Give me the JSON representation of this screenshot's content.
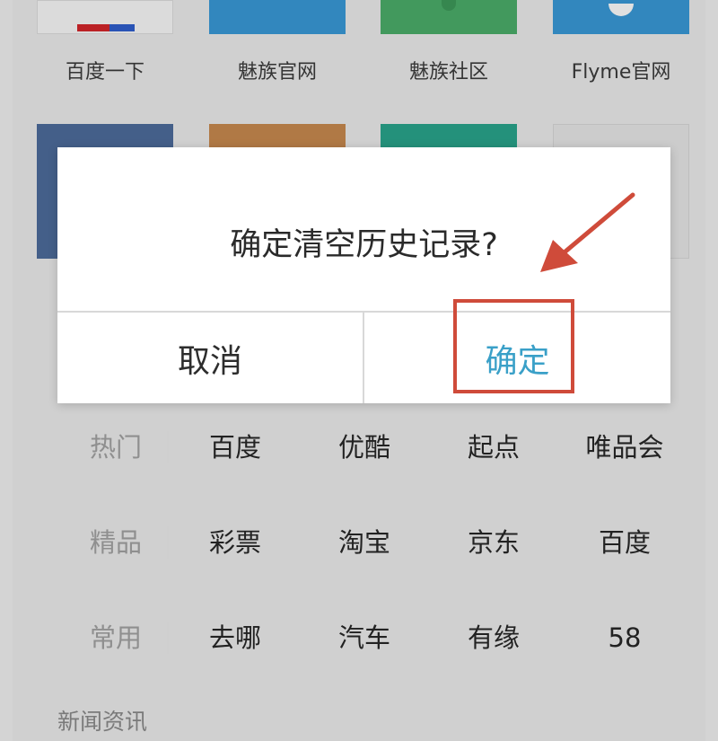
{
  "quick_links_top": [
    {
      "label": "百度一下",
      "color": "#ffffff"
    },
    {
      "label": "魅族官网",
      "color": "#3a9ad9"
    },
    {
      "label": "魅族社区",
      "color": "#4caf6a"
    },
    {
      "label": "Flyme官网",
      "color": "#3a9ad9"
    }
  ],
  "quick_links_second_row_colors": [
    "#4e6d9c",
    "#c98a4f",
    "#2aa68d",
    "#e9e9e9"
  ],
  "dialog": {
    "title": "确定清空历史记录?",
    "cancel_label": "取消",
    "confirm_label": "确定"
  },
  "categories": [
    {
      "name": "热门",
      "links": [
        "百度",
        "优酷",
        "起点",
        "唯品会"
      ]
    },
    {
      "name": "精品",
      "links": [
        "彩票",
        "淘宝",
        "京东",
        "百度"
      ]
    },
    {
      "name": "常用",
      "links": [
        "去哪",
        "汽车",
        "有缘",
        "58"
      ]
    }
  ],
  "news_section_title": "新闻资讯",
  "colors": {
    "confirm_accent": "#3aa0c8",
    "annotation_red": "#cf4b3a"
  }
}
